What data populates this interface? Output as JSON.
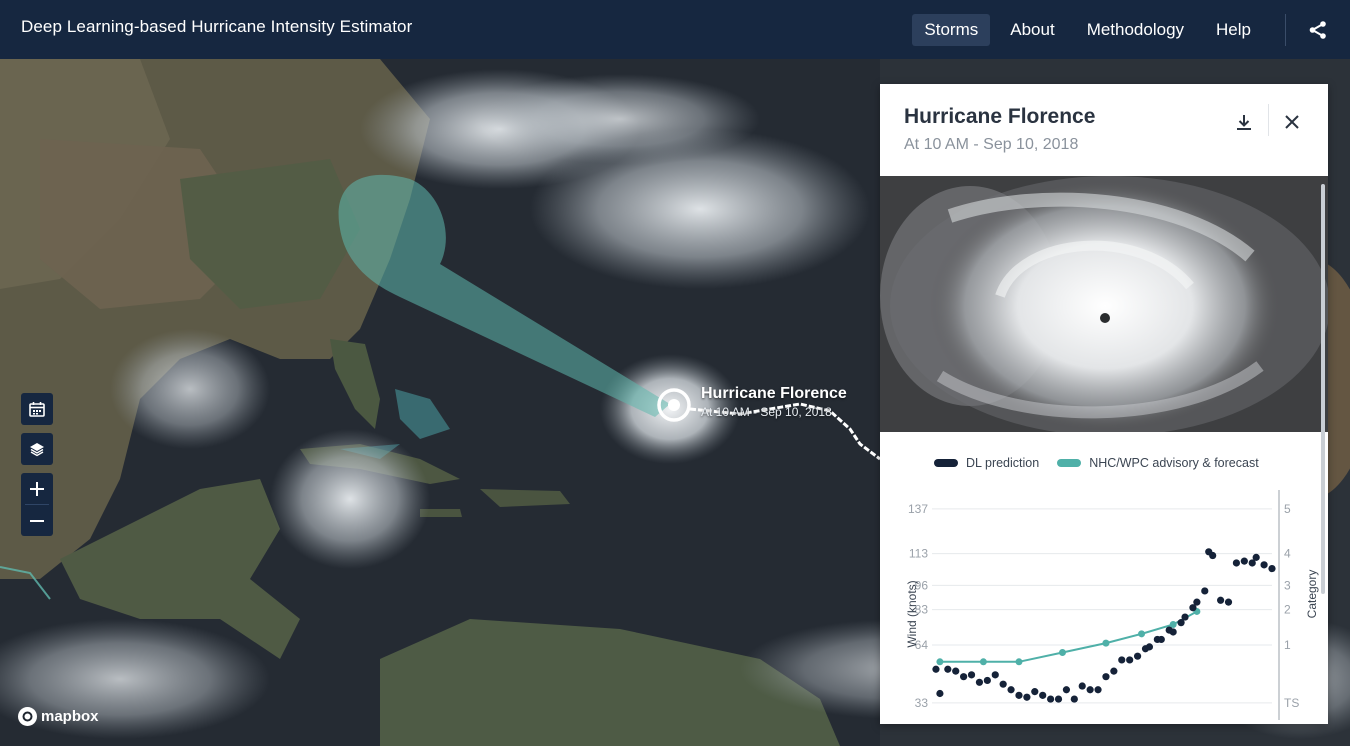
{
  "app": {
    "title": "Deep Learning-based Hurricane Intensity Estimator"
  },
  "nav": {
    "items": [
      {
        "label": "Storms",
        "active": true
      },
      {
        "label": "About",
        "active": false
      },
      {
        "label": "Methodology",
        "active": false
      },
      {
        "label": "Help",
        "active": false
      }
    ],
    "share_icon": "share-icon"
  },
  "map": {
    "storm_label": {
      "name": "Hurricane Florence",
      "time": "At 10 AM - Sep 10, 2018"
    },
    "controls": {
      "calendar_icon": "calendar-icon",
      "layers_icon": "layers-icon",
      "zoom_in": "+",
      "zoom_out": "−"
    },
    "attribution": "mapbox",
    "cone_color": "#5fb8ad",
    "track_color": "#ffffff"
  },
  "panel": {
    "title": "Hurricane Florence",
    "subtitle": "At 10 AM - Sep 10, 2018",
    "download_icon": "download-icon",
    "close_icon": "close-icon",
    "legend": [
      {
        "label": "DL prediction",
        "color": "#152238"
      },
      {
        "label": "NHC/WPC advisory & forecast",
        "color": "#4fb0a8"
      }
    ]
  },
  "chart_data": {
    "type": "scatter",
    "ylabel": "Wind (knots)",
    "y2label": "Category",
    "yticks": [
      33,
      64,
      83,
      96,
      113,
      137
    ],
    "category_ticks": [
      {
        "wind": 33,
        "label": "TS"
      },
      {
        "wind": 64,
        "label": "1"
      },
      {
        "wind": 83,
        "label": "2"
      },
      {
        "wind": 96,
        "label": "3"
      },
      {
        "wind": 113,
        "label": "4"
      },
      {
        "wind": 137,
        "label": "5"
      }
    ],
    "ylim": [
      27,
      145
    ],
    "xlim": [
      0,
      86
    ],
    "grid": true,
    "series": [
      {
        "name": "DL prediction",
        "color": "#152238",
        "points": [
          [
            1,
            51
          ],
          [
            2,
            38
          ],
          [
            4,
            51
          ],
          [
            6,
            50
          ],
          [
            8,
            47
          ],
          [
            10,
            48
          ],
          [
            12,
            44
          ],
          [
            14,
            45
          ],
          [
            16,
            48
          ],
          [
            18,
            43
          ],
          [
            20,
            40
          ],
          [
            22,
            37
          ],
          [
            24,
            36
          ],
          [
            26,
            39
          ],
          [
            28,
            37
          ],
          [
            30,
            35
          ],
          [
            32,
            35
          ],
          [
            34,
            40
          ],
          [
            36,
            35
          ],
          [
            38,
            42
          ],
          [
            40,
            40
          ],
          [
            42,
            40
          ],
          [
            44,
            47
          ],
          [
            46,
            50
          ],
          [
            48,
            56
          ],
          [
            50,
            56
          ],
          [
            52,
            58
          ],
          [
            54,
            62
          ],
          [
            55,
            63
          ],
          [
            57,
            67
          ],
          [
            58,
            67
          ],
          [
            60,
            72
          ],
          [
            61,
            71
          ],
          [
            63,
            76
          ],
          [
            64,
            79
          ],
          [
            66,
            84
          ],
          [
            67,
            87
          ],
          [
            69,
            93
          ],
          [
            70,
            114
          ],
          [
            71,
            112
          ],
          [
            73,
            88
          ],
          [
            75,
            87
          ],
          [
            77,
            108
          ],
          [
            79,
            109
          ],
          [
            81,
            108
          ],
          [
            82,
            111
          ],
          [
            84,
            107
          ],
          [
            86,
            105
          ]
        ]
      },
      {
        "name": "NHC/WPC advisory & forecast",
        "color": "#4fb0a8",
        "points": [
          [
            2,
            55
          ],
          [
            13,
            55
          ],
          [
            22,
            55
          ],
          [
            33,
            60
          ],
          [
            44,
            65
          ],
          [
            53,
            70
          ],
          [
            61,
            75
          ],
          [
            67,
            82
          ]
        ]
      }
    ]
  }
}
